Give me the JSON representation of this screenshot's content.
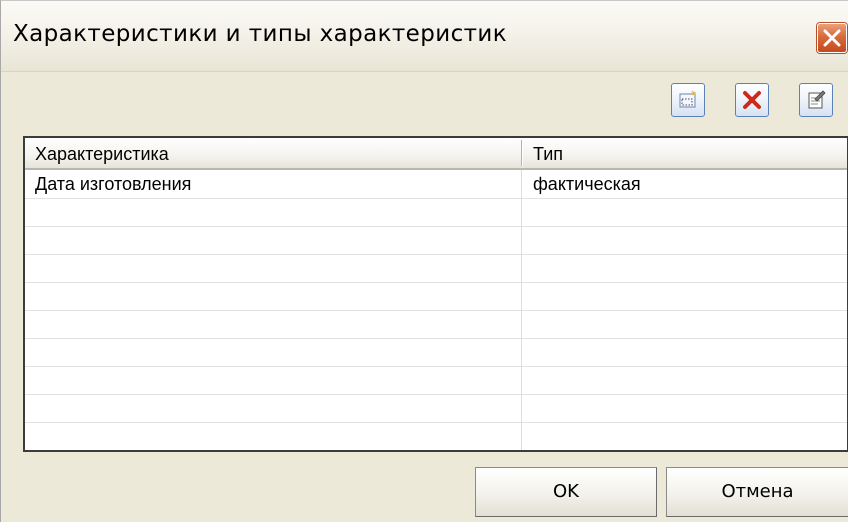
{
  "window": {
    "title": "Характеристики и типы характеристик"
  },
  "toolbar": {
    "buttons": [
      {
        "icon": "new-item-icon"
      },
      {
        "icon": "delete-icon"
      },
      {
        "icon": "properties-icon"
      }
    ]
  },
  "grid": {
    "columns": [
      "Характеристика",
      "Тип"
    ],
    "rows": [
      [
        "Дата изготовления",
        "фактическая"
      ],
      [
        "",
        ""
      ],
      [
        "",
        ""
      ],
      [
        "",
        ""
      ],
      [
        "",
        ""
      ],
      [
        "",
        ""
      ],
      [
        "",
        ""
      ],
      [
        "",
        ""
      ],
      [
        "",
        ""
      ],
      [
        "",
        ""
      ]
    ]
  },
  "buttons": {
    "ok_label": "OK",
    "cancel_label": "Отмена"
  },
  "colors": {
    "dialog_background": "#ece9d8",
    "close_button": "#d96a3c",
    "delete_icon": "#cc2a1a",
    "grid_border": "#3c3c3c"
  }
}
